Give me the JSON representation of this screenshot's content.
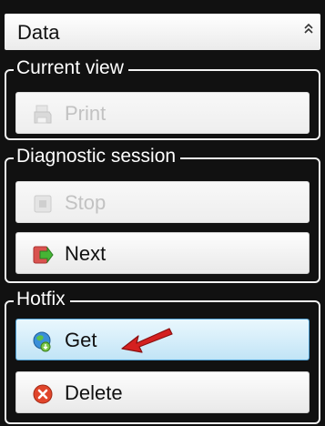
{
  "panel": {
    "title": "Data",
    "collapse_glyph": "»"
  },
  "groups": {
    "current_view": {
      "title": "Current view",
      "print": {
        "label": "Print",
        "icon": "printer-icon",
        "enabled": false
      }
    },
    "diagnostic_session": {
      "title": "Diagnostic session",
      "stop": {
        "label": "Stop",
        "icon": "stop-icon",
        "enabled": false
      },
      "next": {
        "label": "Next",
        "icon": "next-arrow-icon",
        "enabled": true
      }
    },
    "hotfix": {
      "title": "Hotfix",
      "get": {
        "label": "Get",
        "icon": "globe-download-icon",
        "enabled": true,
        "highlighted": true
      },
      "delete": {
        "label": "Delete",
        "icon": "delete-icon",
        "enabled": true
      }
    }
  },
  "annotation": {
    "icon": "red-arrow-icon",
    "color": "#d42020"
  },
  "colors": {
    "panel_bg": "#111111",
    "group_border": "#f2f2f2",
    "highlight_border": "#4d9fd3",
    "disabled_text": "#c2c2c2"
  }
}
